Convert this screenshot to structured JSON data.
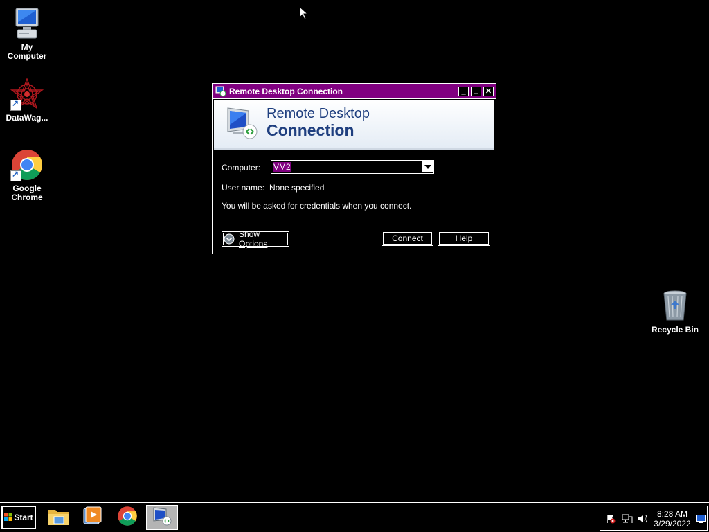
{
  "desktop": {
    "icons": [
      {
        "label": "My Computer",
        "icon": "my-computer-icon"
      },
      {
        "label": "DataWag...",
        "icon": "datawag-icon"
      },
      {
        "label": "Google\nChrome",
        "icon": "chrome-icon"
      },
      {
        "label": "Recycle Bin",
        "icon": "recycle-bin-icon"
      }
    ]
  },
  "dialog": {
    "title": "Remote Desktop Connection",
    "banner_line1": "Remote Desktop",
    "banner_line2": "Connection",
    "computer_label": "Computer:",
    "computer_value": "VM2",
    "username_label": "User name:",
    "username_value": "None specified",
    "credentials_note": "You will be asked for credentials when you connect.",
    "show_options_label": "Show Options",
    "connect_label": "Connect",
    "help_label": "Help",
    "controls": {
      "minimize": "_",
      "maximize": "□",
      "close": "✕"
    },
    "colors": {
      "titlebar": "#800080",
      "selection": "#800080"
    }
  },
  "taskbar": {
    "start_label": "Start",
    "items": [
      {
        "icon": "file-explorer-icon",
        "active": false
      },
      {
        "icon": "media-player-icon",
        "active": false
      },
      {
        "icon": "chrome-icon",
        "active": false
      },
      {
        "icon": "remote-desktop-icon",
        "active": true
      }
    ],
    "tray": {
      "icons": [
        "action-center-flag-icon",
        "network-icon",
        "volume-icon",
        "show-desktop-icon"
      ],
      "time": "8:28 AM",
      "date": "3/29/2022"
    }
  }
}
